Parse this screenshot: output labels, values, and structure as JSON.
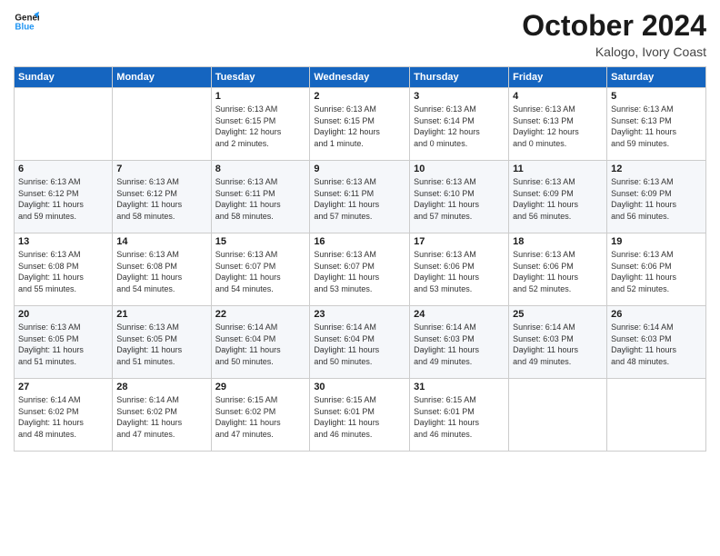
{
  "header": {
    "logo_line1": "General",
    "logo_line2": "Blue",
    "month": "October 2024",
    "location": "Kalogo, Ivory Coast"
  },
  "days_of_week": [
    "Sunday",
    "Monday",
    "Tuesday",
    "Wednesday",
    "Thursday",
    "Friday",
    "Saturday"
  ],
  "weeks": [
    [
      {
        "day": "",
        "info": ""
      },
      {
        "day": "",
        "info": ""
      },
      {
        "day": "1",
        "info": "Sunrise: 6:13 AM\nSunset: 6:15 PM\nDaylight: 12 hours\nand 2 minutes."
      },
      {
        "day": "2",
        "info": "Sunrise: 6:13 AM\nSunset: 6:15 PM\nDaylight: 12 hours\nand 1 minute."
      },
      {
        "day": "3",
        "info": "Sunrise: 6:13 AM\nSunset: 6:14 PM\nDaylight: 12 hours\nand 0 minutes."
      },
      {
        "day": "4",
        "info": "Sunrise: 6:13 AM\nSunset: 6:13 PM\nDaylight: 12 hours\nand 0 minutes."
      },
      {
        "day": "5",
        "info": "Sunrise: 6:13 AM\nSunset: 6:13 PM\nDaylight: 11 hours\nand 59 minutes."
      }
    ],
    [
      {
        "day": "6",
        "info": "Sunrise: 6:13 AM\nSunset: 6:12 PM\nDaylight: 11 hours\nand 59 minutes."
      },
      {
        "day": "7",
        "info": "Sunrise: 6:13 AM\nSunset: 6:12 PM\nDaylight: 11 hours\nand 58 minutes."
      },
      {
        "day": "8",
        "info": "Sunrise: 6:13 AM\nSunset: 6:11 PM\nDaylight: 11 hours\nand 58 minutes."
      },
      {
        "day": "9",
        "info": "Sunrise: 6:13 AM\nSunset: 6:11 PM\nDaylight: 11 hours\nand 57 minutes."
      },
      {
        "day": "10",
        "info": "Sunrise: 6:13 AM\nSunset: 6:10 PM\nDaylight: 11 hours\nand 57 minutes."
      },
      {
        "day": "11",
        "info": "Sunrise: 6:13 AM\nSunset: 6:09 PM\nDaylight: 11 hours\nand 56 minutes."
      },
      {
        "day": "12",
        "info": "Sunrise: 6:13 AM\nSunset: 6:09 PM\nDaylight: 11 hours\nand 56 minutes."
      }
    ],
    [
      {
        "day": "13",
        "info": "Sunrise: 6:13 AM\nSunset: 6:08 PM\nDaylight: 11 hours\nand 55 minutes."
      },
      {
        "day": "14",
        "info": "Sunrise: 6:13 AM\nSunset: 6:08 PM\nDaylight: 11 hours\nand 54 minutes."
      },
      {
        "day": "15",
        "info": "Sunrise: 6:13 AM\nSunset: 6:07 PM\nDaylight: 11 hours\nand 54 minutes."
      },
      {
        "day": "16",
        "info": "Sunrise: 6:13 AM\nSunset: 6:07 PM\nDaylight: 11 hours\nand 53 minutes."
      },
      {
        "day": "17",
        "info": "Sunrise: 6:13 AM\nSunset: 6:06 PM\nDaylight: 11 hours\nand 53 minutes."
      },
      {
        "day": "18",
        "info": "Sunrise: 6:13 AM\nSunset: 6:06 PM\nDaylight: 11 hours\nand 52 minutes."
      },
      {
        "day": "19",
        "info": "Sunrise: 6:13 AM\nSunset: 6:06 PM\nDaylight: 11 hours\nand 52 minutes."
      }
    ],
    [
      {
        "day": "20",
        "info": "Sunrise: 6:13 AM\nSunset: 6:05 PM\nDaylight: 11 hours\nand 51 minutes."
      },
      {
        "day": "21",
        "info": "Sunrise: 6:13 AM\nSunset: 6:05 PM\nDaylight: 11 hours\nand 51 minutes."
      },
      {
        "day": "22",
        "info": "Sunrise: 6:14 AM\nSunset: 6:04 PM\nDaylight: 11 hours\nand 50 minutes."
      },
      {
        "day": "23",
        "info": "Sunrise: 6:14 AM\nSunset: 6:04 PM\nDaylight: 11 hours\nand 50 minutes."
      },
      {
        "day": "24",
        "info": "Sunrise: 6:14 AM\nSunset: 6:03 PM\nDaylight: 11 hours\nand 49 minutes."
      },
      {
        "day": "25",
        "info": "Sunrise: 6:14 AM\nSunset: 6:03 PM\nDaylight: 11 hours\nand 49 minutes."
      },
      {
        "day": "26",
        "info": "Sunrise: 6:14 AM\nSunset: 6:03 PM\nDaylight: 11 hours\nand 48 minutes."
      }
    ],
    [
      {
        "day": "27",
        "info": "Sunrise: 6:14 AM\nSunset: 6:02 PM\nDaylight: 11 hours\nand 48 minutes."
      },
      {
        "day": "28",
        "info": "Sunrise: 6:14 AM\nSunset: 6:02 PM\nDaylight: 11 hours\nand 47 minutes."
      },
      {
        "day": "29",
        "info": "Sunrise: 6:15 AM\nSunset: 6:02 PM\nDaylight: 11 hours\nand 47 minutes."
      },
      {
        "day": "30",
        "info": "Sunrise: 6:15 AM\nSunset: 6:01 PM\nDaylight: 11 hours\nand 46 minutes."
      },
      {
        "day": "31",
        "info": "Sunrise: 6:15 AM\nSunset: 6:01 PM\nDaylight: 11 hours\nand 46 minutes."
      },
      {
        "day": "",
        "info": ""
      },
      {
        "day": "",
        "info": ""
      }
    ]
  ]
}
